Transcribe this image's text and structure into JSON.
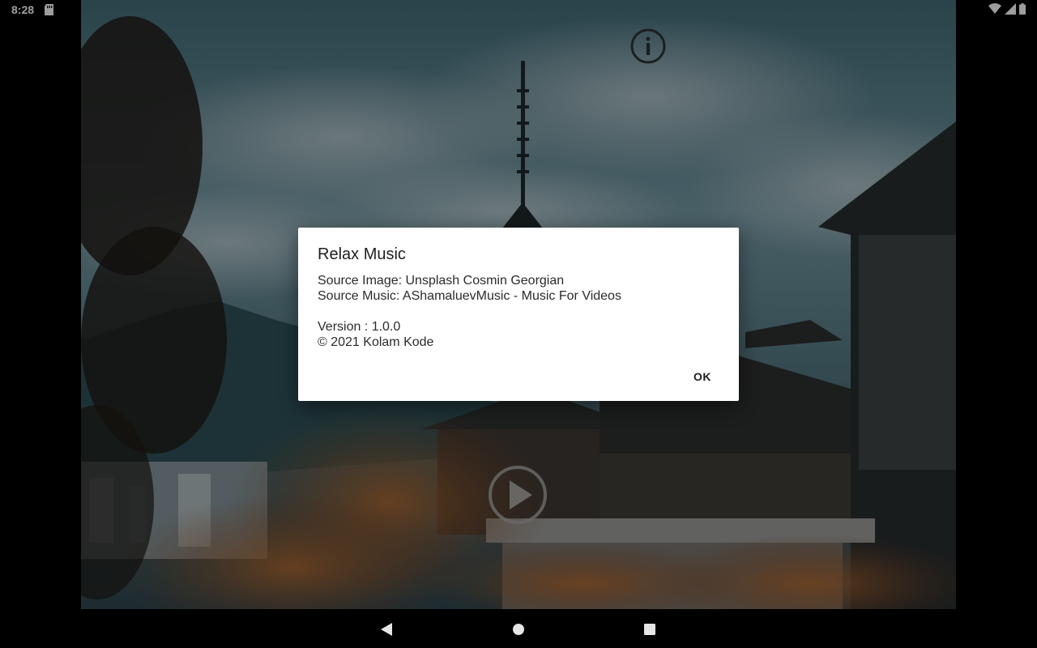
{
  "status_bar": {
    "time": "8:28",
    "icons": [
      "sd-card-icon",
      "wifi-icon",
      "cellular-icon",
      "battery-icon"
    ]
  },
  "background": {
    "description_icon": "temple-landscape-image",
    "accent_sky": "#4b6e79",
    "accent_foliage": "#8a5530"
  },
  "controls": {
    "info_icon": "info-icon",
    "play_icon": "play-icon"
  },
  "dialog": {
    "title": "Relax Music",
    "source_image": "Source Image: Unsplash Cosmin Georgian",
    "source_music": "Source Music: AShamaluevMusic - Music For Videos",
    "version": "Version : 1.0.0",
    "copyright": "© 2021 Kolam Kode",
    "ok_label": "OK"
  },
  "nav_bar": {
    "icons": [
      "back-icon",
      "home-icon",
      "recents-icon"
    ]
  }
}
